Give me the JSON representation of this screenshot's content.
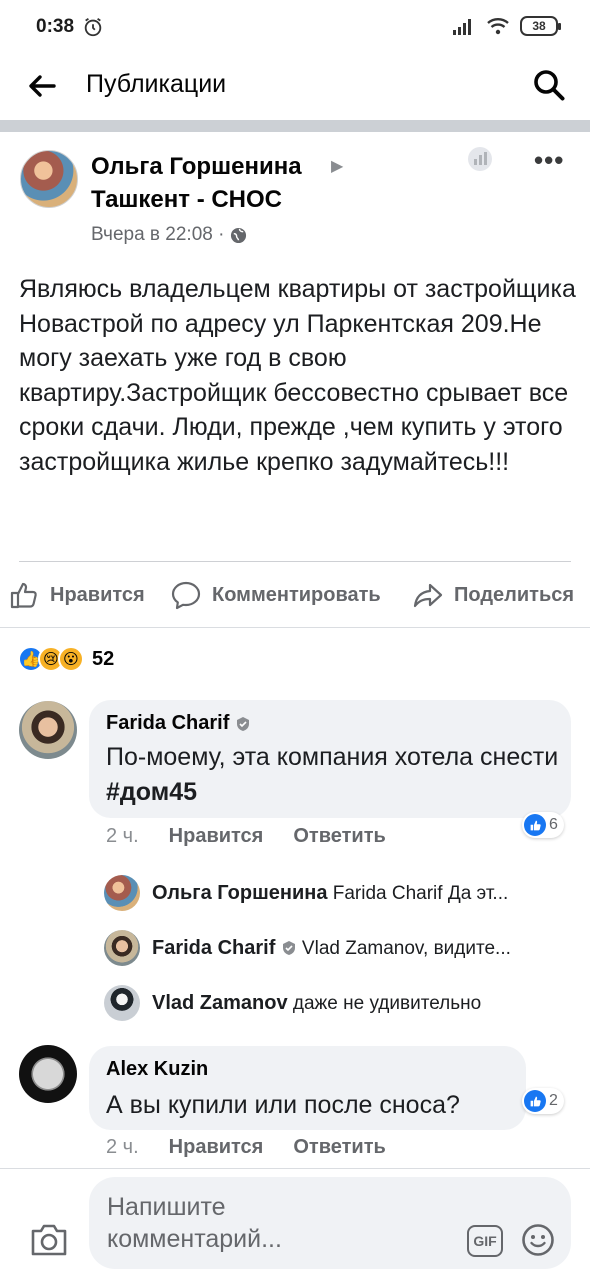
{
  "status_bar": {
    "time": "0:38",
    "battery": "38"
  },
  "header": {
    "title": "Публикации"
  },
  "post": {
    "author": "Ольга Горшенина",
    "group": "Ташкент - СНОС",
    "time": "Вчера в 22:08 ·",
    "text": "Являюсь владельцем квартиры  от застройщика Новастрой по адресу ул Паркентская 209.Не могу заехать уже год в свою квартиру.Застройщик бессовестно срывает все сроки сдачи. Люди, прежде ,чем купить у этого застройщика жилье крепко задумайтесь!!!"
  },
  "actions": {
    "like": "Нравится",
    "comment": "Комментировать",
    "share": "Поделиться"
  },
  "reactions": {
    "count": "52"
  },
  "comments": [
    {
      "name": "Farida Charif",
      "text_main": "По-моему, эта компания хотела снести ",
      "hashtag": "#дом45",
      "time": "2 ч.",
      "like_label": "Нравится",
      "reply_label": "Ответить",
      "likes": "6"
    },
    {
      "name": "Alex Kuzin",
      "text_main": "А вы купили или после сноса?",
      "time": "2 ч.",
      "like_label": "Нравится",
      "reply_label": "Ответить",
      "likes": "2"
    }
  ],
  "replies": [
    {
      "name": "Ольга Горшенина",
      "text": "Farida Charif Да эт..."
    },
    {
      "name": "Farida Charif",
      "text": "Vlad Zamanov, видите..."
    },
    {
      "name": "Vlad Zamanov",
      "text": "даже не удивительно"
    }
  ],
  "composer": {
    "placeholder": "Напишите комментарий..."
  },
  "icons": {
    "back": "arrow-left-icon",
    "search": "search-icon",
    "globe": "globe-icon",
    "insights": "insights-icon",
    "more": "more-icon",
    "like": "thumbs-up-icon",
    "comment": "comment-icon",
    "share": "share-icon",
    "camera": "camera-icon",
    "gif": "gif-icon",
    "emoji": "emoji-icon"
  },
  "colors": {
    "accent": "#1877f2",
    "muted": "#65676b",
    "bubble": "#f0f2f5"
  }
}
